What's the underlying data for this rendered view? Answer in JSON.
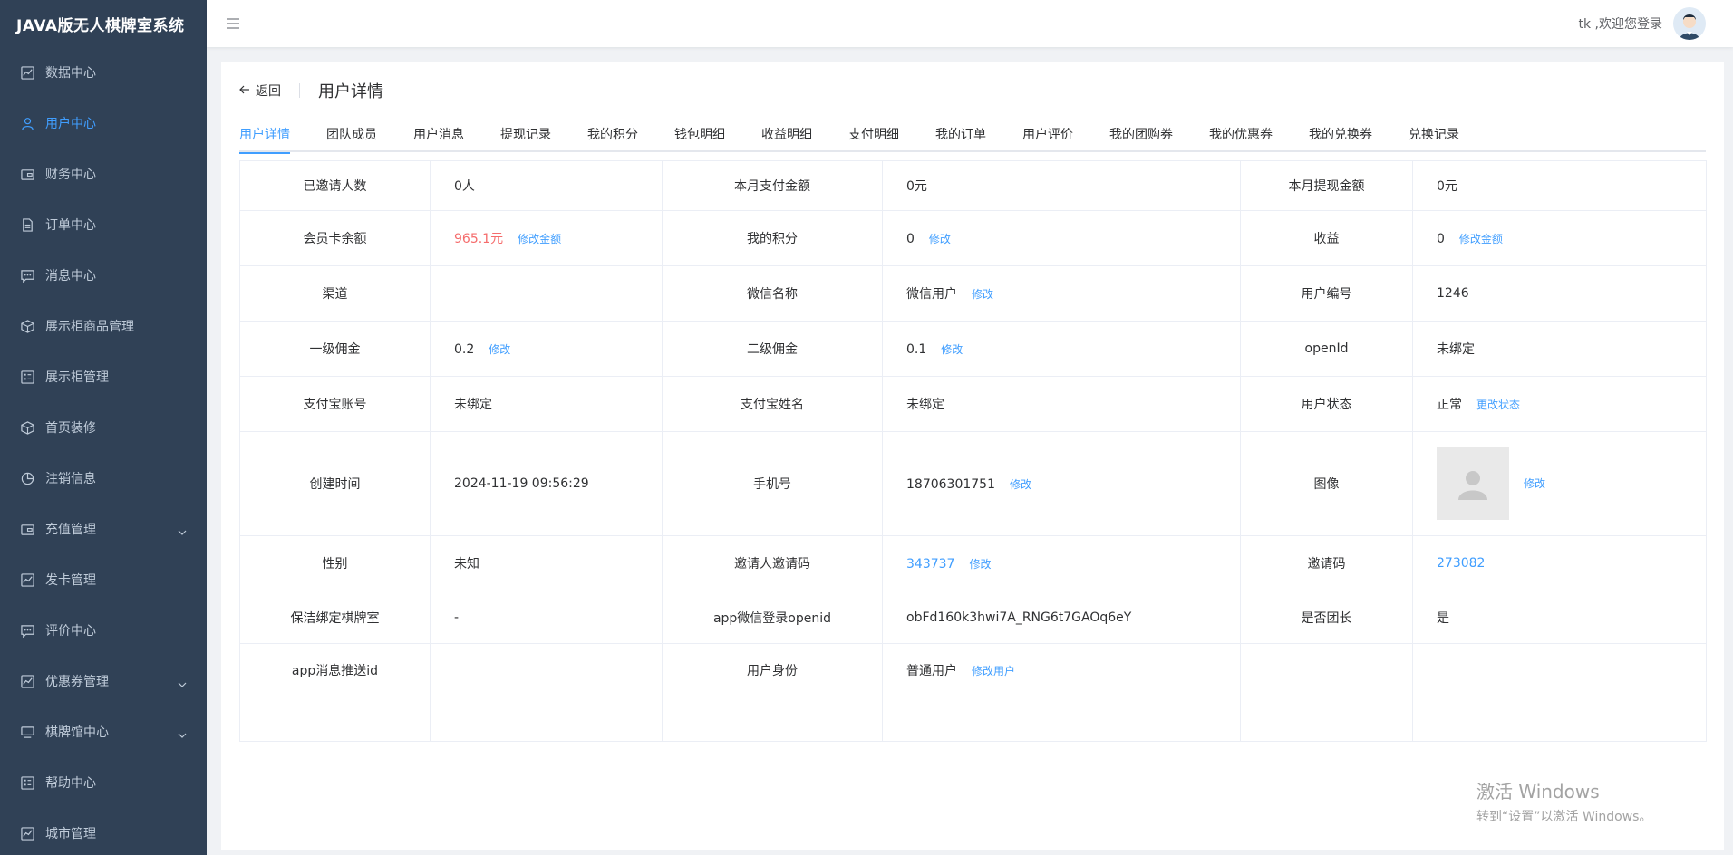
{
  "app": {
    "title": "JAVA版无人棋牌室系统"
  },
  "sidebar": {
    "items": [
      {
        "label": "数据中心",
        "icon": "chart-icon"
      },
      {
        "label": "用户中心",
        "icon": "user-icon"
      },
      {
        "label": "财务中心",
        "icon": "wallet-icon"
      },
      {
        "label": "订单中心",
        "icon": "document-icon"
      },
      {
        "label": "消息中心",
        "icon": "message-icon"
      },
      {
        "label": "展示柜商品管理",
        "icon": "box-icon"
      },
      {
        "label": "展示柜管理",
        "icon": "list-icon"
      },
      {
        "label": "首页装修",
        "icon": "box-icon"
      },
      {
        "label": "注销信息",
        "icon": "pie-icon"
      },
      {
        "label": "充值管理",
        "icon": "wallet-icon"
      },
      {
        "label": "发卡管理",
        "icon": "chart-icon"
      },
      {
        "label": "评价中心",
        "icon": "message-icon"
      },
      {
        "label": "优惠券管理",
        "icon": "chart-icon"
      },
      {
        "label": "棋牌馆中心",
        "icon": "monitor-icon"
      },
      {
        "label": "帮助中心",
        "icon": "list-icon"
      },
      {
        "label": "城市管理",
        "icon": "chart-icon"
      }
    ]
  },
  "topbar": {
    "welcome": "tk ,欢迎您登录"
  },
  "page": {
    "back_label": "返回",
    "title": "用户详情"
  },
  "tabs": [
    "用户详情",
    "团队成员",
    "用户消息",
    "提现记录",
    "我的积分",
    "钱包明细",
    "收益明细",
    "支付明细",
    "我的订单",
    "用户评价",
    "我的团购券",
    "我的优惠券",
    "我的兑换券",
    "兑换记录"
  ],
  "detail": {
    "r0": {
      "l1": "已邀请人数",
      "v1": "0人",
      "l2": "本月支付金额",
      "v2": "0元",
      "l3": "本月提现金额",
      "v3": "0元"
    },
    "r1": {
      "l1": "会员卡余额",
      "v1": "965.1元",
      "a1": "修改金额",
      "l2": "我的积分",
      "v2": "0",
      "a2": "修改",
      "l3": "收益",
      "v3": "0",
      "a3": "修改金额"
    },
    "r2": {
      "l1": "渠道",
      "v1": "",
      "l2": "微信名称",
      "v2": "微信用户",
      "a2": "修改",
      "l3": "用户编号",
      "v3": "1246"
    },
    "r3": {
      "l1": "一级佣金",
      "v1": "0.2",
      "a1": "修改",
      "l2": "二级佣金",
      "v2": "0.1",
      "a2": "修改",
      "l3": "openId",
      "v3": "未绑定"
    },
    "r4": {
      "l1": "支付宝账号",
      "v1": "未绑定",
      "l2": "支付宝姓名",
      "v2": "未绑定",
      "l3": "用户状态",
      "v3": "正常",
      "a3": "更改状态"
    },
    "r5": {
      "l1": "创建时间",
      "v1": "2024-11-19 09:56:29",
      "l2": "手机号",
      "v2": "18706301751",
      "a2": "修改",
      "l3": "图像",
      "a3": "修改"
    },
    "r6": {
      "l1": "性别",
      "v1": "未知",
      "l2": "邀请人邀请码",
      "v2": "343737",
      "a2": "修改",
      "l3": "邀请码",
      "v3": "273082"
    },
    "r7": {
      "l1": "保洁绑定棋牌室",
      "v1": "-",
      "l2": "app微信登录openid",
      "v2": "obFd160k3hwi7A_RNG6t7GAOq6eY",
      "l3": "是否团长",
      "v3": "是"
    },
    "r8": {
      "l1": "app消息推送id",
      "v1": "",
      "l2": "用户身份",
      "v2": "普通用户",
      "a2": "修改用户",
      "l3": "",
      "v3": ""
    }
  },
  "watermark": {
    "line1": "激活 Windows",
    "line2": "转到“设置”以激活 Windows。"
  },
  "colors": {
    "sidebar_bg": "#304156",
    "accent": "#409eff",
    "danger": "#f56c6c"
  }
}
